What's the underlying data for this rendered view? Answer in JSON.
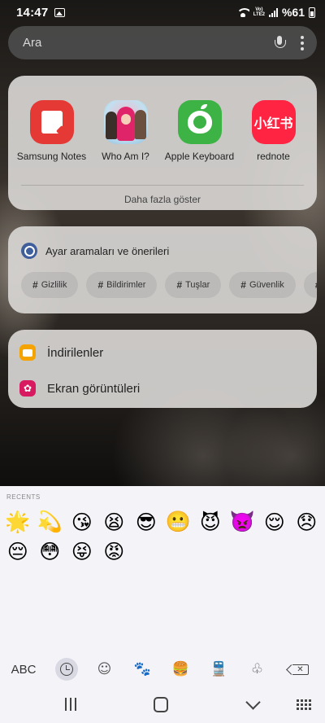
{
  "status_bar": {
    "time": "14:47",
    "network_label": "Vo) LTE2",
    "battery_text": "%61"
  },
  "search": {
    "placeholder": "Ara"
  },
  "apps": {
    "items": [
      {
        "label": "Samsung Notes",
        "icon": "samsung-notes-icon"
      },
      {
        "label": "Who Am I?",
        "icon": "who-am-i-icon"
      },
      {
        "label": "Apple Keyboard",
        "icon": "apple-keyboard-icon"
      },
      {
        "label": "rednote",
        "icon": "rednote-icon",
        "glyph": "小红书"
      }
    ],
    "more_label": "Daha fazla göster"
  },
  "settings": {
    "title": "Ayar aramaları ve önerileri",
    "chips": [
      "Gizlilik",
      "Bildirimler",
      "Tuşlar",
      "Güvenlik",
      ""
    ]
  },
  "folders": {
    "items": [
      {
        "label": "İndirilenler",
        "icon": "folder-icon"
      },
      {
        "label": "Ekran görüntüleri",
        "icon": "flower-icon",
        "glyph": "✿"
      }
    ]
  },
  "keyboard": {
    "recents_label": "RECENTS",
    "emojis": [
      "🌟",
      "💫",
      "😘",
      "😫",
      "😎",
      "😬",
      "😈",
      "👿",
      "😌",
      "😞",
      "😔",
      "😳",
      "😝",
      "😡"
    ],
    "abc_label": "ABC",
    "categories": [
      {
        "name": "recents-clock-icon",
        "active": true
      },
      {
        "name": "smiley-icon",
        "glyph": "☺"
      },
      {
        "name": "paw-icon",
        "glyph": "🐾"
      },
      {
        "name": "food-icon",
        "glyph": "🍔"
      },
      {
        "name": "transport-icon",
        "glyph": "🚆"
      },
      {
        "name": "symbols-icon",
        "glyph": "♧"
      }
    ]
  },
  "colors": {
    "samsung_notes": "#e53935",
    "apple_keyboard": "#3db346",
    "rednote": "#ff2442",
    "settings_gear": "#3e5f9c",
    "downloads_folder": "#f5a300",
    "screenshots_folder": "#d81b60"
  }
}
